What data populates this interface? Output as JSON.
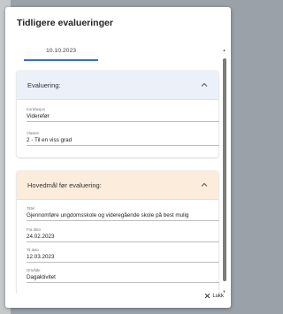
{
  "dialog": {
    "title": "Tidligere evalueringer",
    "tab_label": "10.10.2023",
    "close_label": "Lukk"
  },
  "sections": {
    "evaluering": {
      "title": "Evaluering:",
      "fields": [
        {
          "label": "Konklusjon",
          "value": "Viderefør"
        },
        {
          "label": "Vlasten",
          "value": "2 - Til en viss grad"
        }
      ]
    },
    "hovedmal": {
      "title": "Hovedmål før evaluering:",
      "fields": [
        {
          "label": "Tittel",
          "value": "Gjennomføre ungdomsskole og videregående skole på best mulig"
        },
        {
          "label": "Fra dato",
          "value": "24.02.2023"
        },
        {
          "label": "Til dato",
          "value": "12.03.2023"
        },
        {
          "label": "Område",
          "value": "Dagaktivitet"
        }
      ]
    }
  },
  "colors": {
    "accent": "#3b6fb6",
    "evaluering_header_bg": "#ecf0f8",
    "hovedmal_header_bg": "#fcecdc",
    "backdrop": "#9aa1a8"
  },
  "icons": {
    "chevron": "chevron-up-icon",
    "close": "close-icon"
  }
}
